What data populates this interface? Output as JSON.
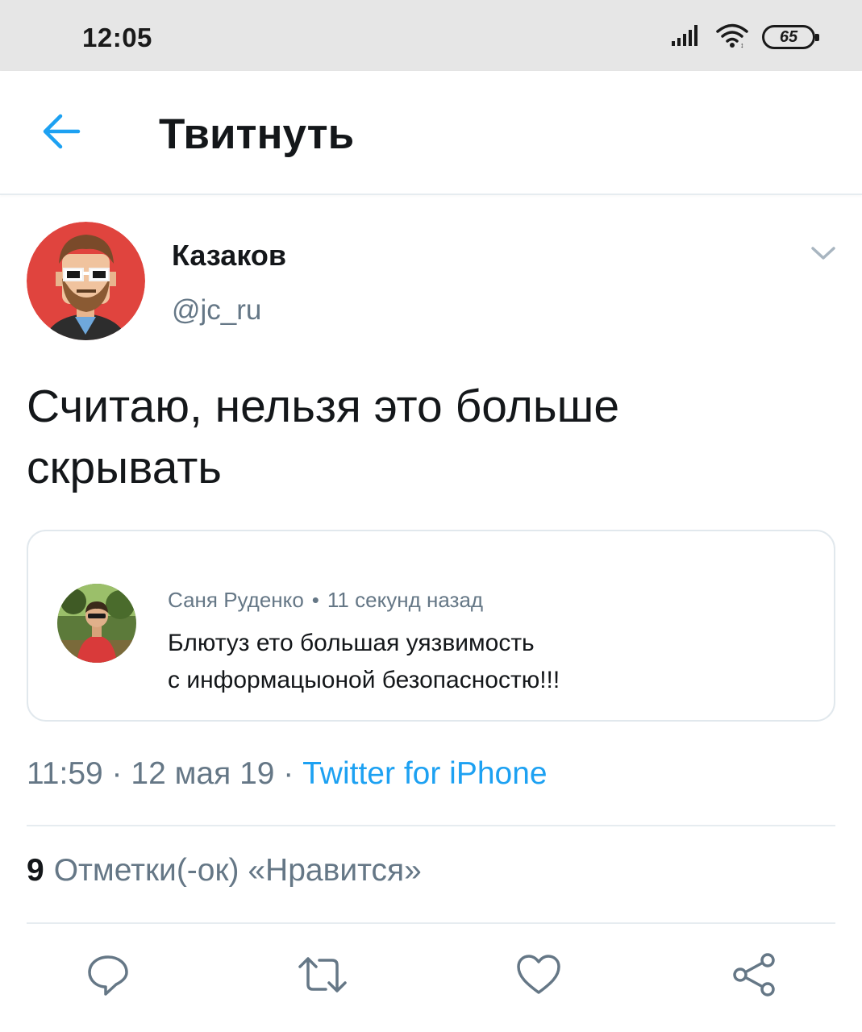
{
  "status_bar": {
    "time": "12:05",
    "battery": "65",
    "icons": [
      "signal-icon",
      "wifi-icon",
      "battery-icon"
    ]
  },
  "header": {
    "title": "Твитнуть",
    "back_icon": "back-arrow-icon"
  },
  "tweet": {
    "author_name": "Казаков",
    "author_handle": "@jc_ru",
    "text": "Считаю, нельзя это больше скрывать",
    "quoted": {
      "author": "Саня Руденко",
      "separator": "•",
      "time": "11 секунд назад",
      "text_line1": "Блютуз ето большая уязвимость",
      "text_line2": "с информацыоной безопасностю!!!"
    },
    "time": "11:59",
    "sep": "·",
    "date": "12 мая 19",
    "source": "Twitter for iPhone",
    "likes_count": "9",
    "likes_label": "Отметки(-ок) «Нравится»"
  },
  "actions": [
    "reply-icon",
    "retweet-icon",
    "like-icon",
    "share-icon"
  ],
  "colors": {
    "accent": "#1da1f2",
    "secondary_text": "#657786",
    "primary_text": "#14171a",
    "avatar_background": "#e0443e"
  }
}
